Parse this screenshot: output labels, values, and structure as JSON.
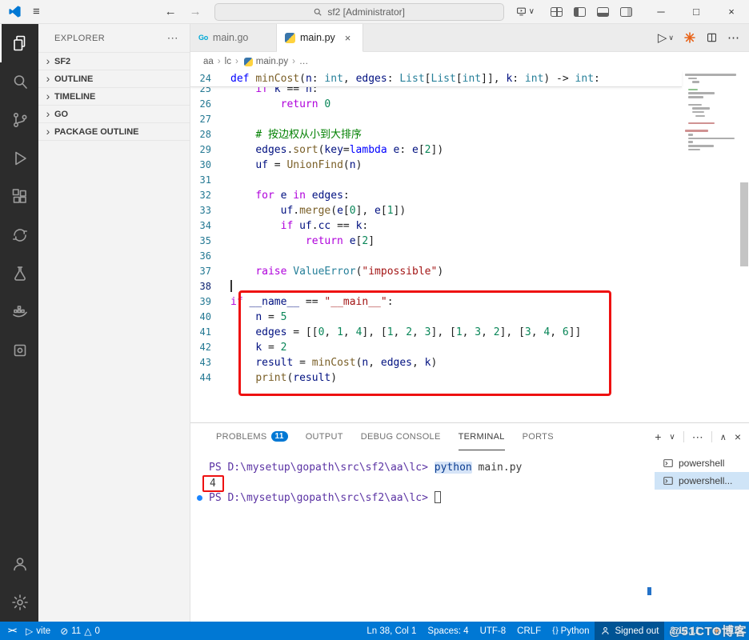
{
  "titlebar": {
    "menu_icon": "≡",
    "search_text": "sf2 [Administrator]",
    "nav": {
      "back": "←",
      "forward": "→"
    },
    "monitor_dropdown": "∨",
    "window_controls": {
      "minimize": "─",
      "maximize": "□",
      "close": "×"
    }
  },
  "activity_bar": {
    "items": [
      "explorer",
      "search",
      "source-control",
      "run-debug",
      "extensions",
      "remote-explorer",
      "testing",
      "docker",
      "tools"
    ],
    "bottom": [
      "accounts",
      "settings"
    ]
  },
  "sidebar": {
    "title": "EXPLORER",
    "more": "⋯",
    "sections": [
      {
        "label": "SF2"
      },
      {
        "label": "OUTLINE"
      },
      {
        "label": "TIMELINE"
      },
      {
        "label": "GO"
      },
      {
        "label": "PACKAGE OUTLINE"
      }
    ]
  },
  "editor": {
    "tabs": [
      {
        "label": "main.go",
        "icon_text": "Go",
        "active": false
      },
      {
        "label": "main.py",
        "active": true,
        "close": "×"
      }
    ],
    "actions": {
      "run": "▷",
      "run_dropdown": "∨",
      "more": "⋯"
    },
    "breadcrumb": {
      "separator": "›",
      "items": [
        {
          "label": "aa"
        },
        {
          "label": "lc"
        },
        {
          "label": "main.py",
          "icon": "python"
        },
        {
          "label": "…"
        }
      ]
    },
    "lines": [
      {
        "num": 24,
        "sticky": true,
        "tokens": [
          [
            "def",
            "kw"
          ],
          [
            " ",
            "pl"
          ],
          [
            "minCost",
            "fn"
          ],
          [
            "(",
            "pl"
          ],
          [
            "n",
            "var"
          ],
          [
            ": ",
            "pl"
          ],
          [
            "int",
            "type"
          ],
          [
            ", ",
            "pl"
          ],
          [
            "edges",
            "var"
          ],
          [
            ": ",
            "pl"
          ],
          [
            "List",
            "type"
          ],
          [
            "[",
            "pl"
          ],
          [
            "List",
            "type"
          ],
          [
            "[",
            "pl"
          ],
          [
            "int",
            "type"
          ],
          [
            "]], ",
            "pl"
          ],
          [
            "k",
            "var"
          ],
          [
            ": ",
            "pl"
          ],
          [
            "int",
            "type"
          ],
          [
            ") -> ",
            "pl"
          ],
          [
            "int",
            "type"
          ],
          [
            ":",
            "pl"
          ]
        ]
      },
      {
        "num": 25,
        "clip": true,
        "tokens": [
          [
            "    ",
            "pl"
          ],
          [
            "if",
            "ctl"
          ],
          [
            " ",
            "pl"
          ],
          [
            "k",
            "var"
          ],
          [
            " == ",
            "pl"
          ],
          [
            "n",
            "var"
          ],
          [
            ":",
            "pl"
          ]
        ]
      },
      {
        "num": 26,
        "tokens": [
          [
            "        ",
            "pl"
          ],
          [
            "return",
            "ctl"
          ],
          [
            " ",
            "pl"
          ],
          [
            "0",
            "num"
          ]
        ]
      },
      {
        "num": 27,
        "tokens": []
      },
      {
        "num": 28,
        "tokens": [
          [
            "    ",
            "pl"
          ],
          [
            "# 按边权从小到大排序",
            "com"
          ]
        ]
      },
      {
        "num": 29,
        "tokens": [
          [
            "    ",
            "pl"
          ],
          [
            "edges",
            "var"
          ],
          [
            ".",
            "pl"
          ],
          [
            "sort",
            "fn"
          ],
          [
            "(",
            "pl"
          ],
          [
            "key",
            "var"
          ],
          [
            "=",
            "pl"
          ],
          [
            "lambda",
            "kw"
          ],
          [
            " ",
            "pl"
          ],
          [
            "e",
            "var"
          ],
          [
            ": ",
            "pl"
          ],
          [
            "e",
            "var"
          ],
          [
            "[",
            "pl"
          ],
          [
            "2",
            "num"
          ],
          [
            "])",
            "pl"
          ]
        ]
      },
      {
        "num": 30,
        "tokens": [
          [
            "    ",
            "pl"
          ],
          [
            "uf",
            "var"
          ],
          [
            " = ",
            "pl"
          ],
          [
            "UnionFind",
            "fn"
          ],
          [
            "(",
            "pl"
          ],
          [
            "n",
            "var"
          ],
          [
            ")",
            "pl"
          ]
        ]
      },
      {
        "num": 31,
        "tokens": []
      },
      {
        "num": 32,
        "tokens": [
          [
            "    ",
            "pl"
          ],
          [
            "for",
            "ctl"
          ],
          [
            " ",
            "pl"
          ],
          [
            "e",
            "var"
          ],
          [
            " ",
            "pl"
          ],
          [
            "in",
            "ctl"
          ],
          [
            " ",
            "pl"
          ],
          [
            "edges",
            "var"
          ],
          [
            ":",
            "pl"
          ]
        ]
      },
      {
        "num": 33,
        "tokens": [
          [
            "        ",
            "pl"
          ],
          [
            "uf",
            "var"
          ],
          [
            ".",
            "pl"
          ],
          [
            "merge",
            "fn"
          ],
          [
            "(",
            "pl"
          ],
          [
            "e",
            "var"
          ],
          [
            "[",
            "pl"
          ],
          [
            "0",
            "num"
          ],
          [
            "], ",
            "pl"
          ],
          [
            "e",
            "var"
          ],
          [
            "[",
            "pl"
          ],
          [
            "1",
            "num"
          ],
          [
            "])",
            "pl"
          ]
        ]
      },
      {
        "num": 34,
        "tokens": [
          [
            "        ",
            "pl"
          ],
          [
            "if",
            "ctl"
          ],
          [
            " ",
            "pl"
          ],
          [
            "uf",
            "var"
          ],
          [
            ".",
            "pl"
          ],
          [
            "cc",
            "var"
          ],
          [
            " == ",
            "pl"
          ],
          [
            "k",
            "var"
          ],
          [
            ":",
            "pl"
          ]
        ]
      },
      {
        "num": 35,
        "tokens": [
          [
            "            ",
            "pl"
          ],
          [
            "return",
            "ctl"
          ],
          [
            " ",
            "pl"
          ],
          [
            "e",
            "var"
          ],
          [
            "[",
            "pl"
          ],
          [
            "2",
            "num"
          ],
          [
            "]",
            "pl"
          ]
        ]
      },
      {
        "num": 36,
        "tokens": []
      },
      {
        "num": 37,
        "tokens": [
          [
            "    ",
            "pl"
          ],
          [
            "raise",
            "ctl"
          ],
          [
            " ",
            "pl"
          ],
          [
            "ValueError",
            "type"
          ],
          [
            "(",
            "pl"
          ],
          [
            "\"impossible\"",
            "str"
          ],
          [
            ")",
            "pl"
          ]
        ]
      },
      {
        "num": 38,
        "active": true,
        "cursor": true,
        "tokens": []
      },
      {
        "num": 39,
        "tokens": [
          [
            "if",
            "ctl"
          ],
          [
            " ",
            "pl"
          ],
          [
            "__name__",
            "var"
          ],
          [
            " == ",
            "pl"
          ],
          [
            "\"__main__\"",
            "str"
          ],
          [
            ":",
            "pl"
          ]
        ]
      },
      {
        "num": 40,
        "tokens": [
          [
            "    ",
            "pl"
          ],
          [
            "n",
            "var"
          ],
          [
            " = ",
            "pl"
          ],
          [
            "5",
            "num"
          ]
        ]
      },
      {
        "num": 41,
        "tokens": [
          [
            "    ",
            "pl"
          ],
          [
            "edges",
            "var"
          ],
          [
            " = [[",
            "pl"
          ],
          [
            "0",
            "num"
          ],
          [
            ", ",
            "pl"
          ],
          [
            "1",
            "num"
          ],
          [
            ", ",
            "pl"
          ],
          [
            "4",
            "num"
          ],
          [
            "], [",
            "pl"
          ],
          [
            "1",
            "num"
          ],
          [
            ", ",
            "pl"
          ],
          [
            "2",
            "num"
          ],
          [
            ", ",
            "pl"
          ],
          [
            "3",
            "num"
          ],
          [
            "], [",
            "pl"
          ],
          [
            "1",
            "num"
          ],
          [
            ", ",
            "pl"
          ],
          [
            "3",
            "num"
          ],
          [
            ", ",
            "pl"
          ],
          [
            "2",
            "num"
          ],
          [
            "], [",
            "pl"
          ],
          [
            "3",
            "num"
          ],
          [
            ", ",
            "pl"
          ],
          [
            "4",
            "num"
          ],
          [
            ", ",
            "pl"
          ],
          [
            "6",
            "num"
          ],
          [
            "]]",
            "pl"
          ]
        ]
      },
      {
        "num": 42,
        "tokens": [
          [
            "    ",
            "pl"
          ],
          [
            "k",
            "var"
          ],
          [
            " = ",
            "pl"
          ],
          [
            "2",
            "num"
          ]
        ]
      },
      {
        "num": 43,
        "tokens": [
          [
            "    ",
            "pl"
          ],
          [
            "result",
            "var"
          ],
          [
            " = ",
            "pl"
          ],
          [
            "minCost",
            "fn"
          ],
          [
            "(",
            "pl"
          ],
          [
            "n",
            "var"
          ],
          [
            ", ",
            "pl"
          ],
          [
            "edges",
            "var"
          ],
          [
            ", ",
            "pl"
          ],
          [
            "k",
            "var"
          ],
          [
            ")",
            "pl"
          ]
        ]
      },
      {
        "num": 44,
        "tokens": [
          [
            "    ",
            "pl"
          ],
          [
            "print",
            "fn"
          ],
          [
            "(",
            "pl"
          ],
          [
            "result",
            "var"
          ],
          [
            ")",
            "pl"
          ]
        ]
      }
    ]
  },
  "panel": {
    "tabs": [
      {
        "label": "PROBLEMS",
        "badge": "11"
      },
      {
        "label": "OUTPUT"
      },
      {
        "label": "DEBUG CONSOLE"
      },
      {
        "label": "TERMINAL",
        "active": true
      },
      {
        "label": "PORTS"
      }
    ],
    "actions": {
      "new": "+",
      "dropdown": "∨",
      "more": "⋯",
      "maximize": "∧",
      "close": "×"
    },
    "terminal": {
      "lines": [
        {
          "tokens": [
            [
              "PS D:\\mysetup\\gopath\\src\\sf2\\aa\\lc>",
              "prompt"
            ],
            [
              " ",
              "out"
            ],
            [
              "python",
              "cmd"
            ],
            [
              " main.py",
              "out"
            ]
          ]
        },
        {
          "boxed": true,
          "tokens": [
            [
              "4",
              "out"
            ]
          ]
        },
        {
          "decorated": true,
          "cursor": true,
          "tokens": [
            [
              "PS D:\\mysetup\\gopath\\src\\sf2\\aa\\lc>",
              "prompt"
            ],
            [
              " ",
              "out"
            ]
          ]
        }
      ],
      "list": [
        {
          "label": "powershell",
          "selected": false
        },
        {
          "label": "powershell...",
          "selected": true
        }
      ]
    }
  },
  "status": {
    "left": {
      "remote_glyph": "><",
      "task_glyph": "▷",
      "task_label": "vite",
      "error_glyph": "⊘",
      "errors": "11",
      "warning_glyph": "△",
      "warnings": "0"
    },
    "right": {
      "cursor": "Ln 38, Col 1",
      "indent": "Spaces: 4",
      "encoding": "UTF-8",
      "eol": "CRLF",
      "lang_icon": "{ }",
      "language": "Python",
      "signin": "Signed out",
      "version": "3.12.11"
    }
  },
  "watermark": "@51CTO博客"
}
